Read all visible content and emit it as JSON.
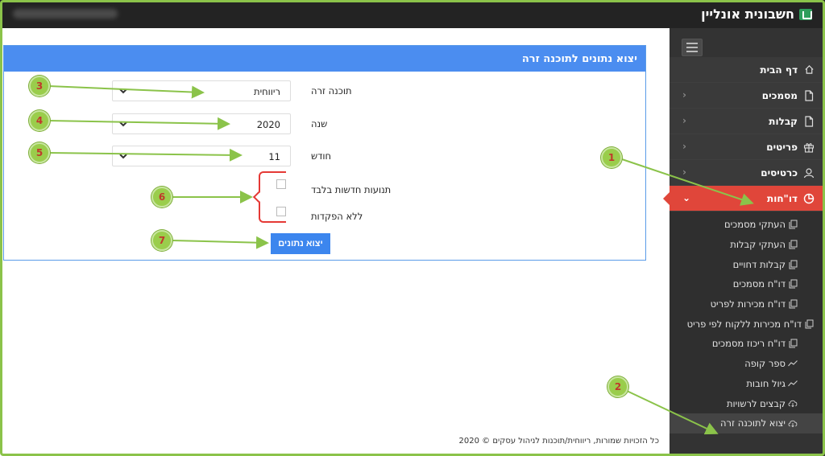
{
  "app": {
    "brand": "חשבונית אונליין"
  },
  "sidebar": {
    "items": [
      {
        "label": "דף הבית",
        "icon": "home-icon"
      },
      {
        "label": "מסמכים",
        "icon": "document-icon"
      },
      {
        "label": "קבלות",
        "icon": "receipt-icon"
      },
      {
        "label": "פריטים",
        "icon": "gift-icon"
      },
      {
        "label": "כרטיסים",
        "icon": "user-icon"
      },
      {
        "label": "דו\"חות",
        "icon": "pie-chart-icon"
      }
    ],
    "submenu": [
      {
        "label": "העתקי מסמכים",
        "icon": "copy-icon"
      },
      {
        "label": "העתקי קבלות",
        "icon": "copy-icon"
      },
      {
        "label": "קבלות דחויים",
        "icon": "copy-icon"
      },
      {
        "label": "דו\"ח מסמכים",
        "icon": "copy-icon"
      },
      {
        "label": "דו\"ח מכירות לפריט",
        "icon": "copy-icon"
      },
      {
        "label": "דו\"ח מכירות ללקוח לפי פריט",
        "icon": "copy-icon"
      },
      {
        "label": "דו\"ח ריכוז מסמכים",
        "icon": "copy-icon"
      },
      {
        "label": "ספר קופה",
        "icon": "trend-icon"
      },
      {
        "label": "גיול חובות",
        "icon": "trend-icon"
      },
      {
        "label": "קבצים לרשויות",
        "icon": "cloud-download-icon"
      },
      {
        "label": "יצוא לתוכנה זרה",
        "icon": "cloud-download-icon"
      }
    ]
  },
  "panel": {
    "title": "יצוא נתונים לתוכנה זרה",
    "fields": {
      "software": {
        "label": "תוכנה זרה",
        "value": "ריווחית"
      },
      "year": {
        "label": "שנה",
        "value": "2020"
      },
      "month": {
        "label": "חודש",
        "value": "11"
      }
    },
    "checkboxes": {
      "new_only": "תנועות חדשות בלבד",
      "no_deposits": "ללא הפקדות"
    },
    "export_button": "יצוא נתונים"
  },
  "footer": {
    "text": "כל הזכויות שמורות, ריווחית/תוכנות לניהול עסקים © 2020"
  },
  "annotations": [
    "1",
    "2",
    "3",
    "4",
    "5",
    "6",
    "7"
  ],
  "colors": {
    "header_blue": "#4b8df0",
    "active_red": "#e0463a",
    "marker_green": "#9acd4c",
    "sidebar_dark": "#333333"
  }
}
